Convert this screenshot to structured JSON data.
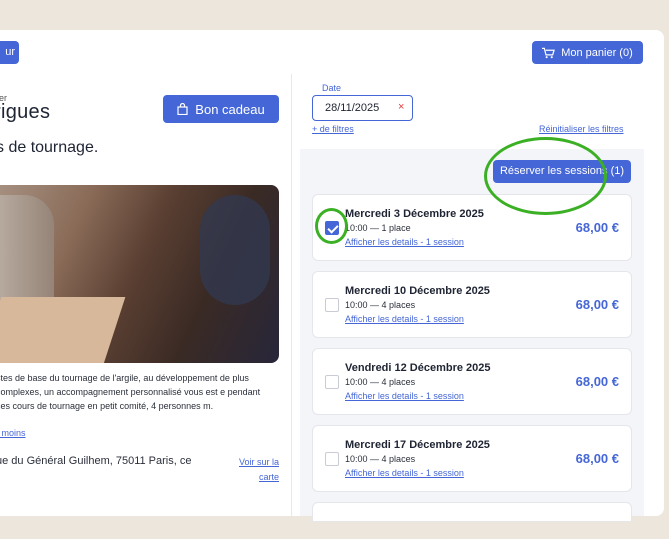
{
  "header": {
    "back_label": "ur",
    "cart_label": "Mon panier (0)"
  },
  "workshop": {
    "brand_small": "ier",
    "brand_big": "rigues",
    "gift_label": "Bon cadeau",
    "subtitle": "s de tournage.",
    "description": "stes de base du tournage de l'argile, au développement de plus complexes, un accompagnement personnalisé vous est e pendant ces cours de tournage en petit comité, 4 personnes m.",
    "less_link": "r moins",
    "address": "ue du Général Guilhem, 75011 Paris, ce",
    "map_link": "Voir sur la carte"
  },
  "filters": {
    "date_label": "Date",
    "date_value": "28/11/2025",
    "clear_symbol": "×",
    "more_filters": "+ de filtres",
    "reset_filters": "Réinitialiser les filtres"
  },
  "reserve_label": "Réserver les sessions (1)",
  "sessions": [
    {
      "title": "Mercredi 3 Décembre 2025",
      "time": "10:00",
      "places": "1 place",
      "details": "Afficher les details - 1 session",
      "price": "68,00 €",
      "checked": true
    },
    {
      "title": "Mercredi 10 Décembre 2025",
      "time": "10:00",
      "places": "4 places",
      "details": "Afficher les details - 1 session",
      "price": "68,00 €",
      "checked": false
    },
    {
      "title": "Vendredi 12 Décembre 2025",
      "time": "10:00",
      "places": "4 places",
      "details": "Afficher les details - 1 session",
      "price": "68,00 €",
      "checked": false
    },
    {
      "title": "Mercredi 17 Décembre 2025",
      "time": "10:00",
      "places": "4 places",
      "details": "Afficher les details - 1 session",
      "price": "68,00 €",
      "checked": false
    }
  ],
  "colors": {
    "accent": "#4466d6",
    "annotation": "#3cb025",
    "page_bg": "#ece6dc"
  }
}
